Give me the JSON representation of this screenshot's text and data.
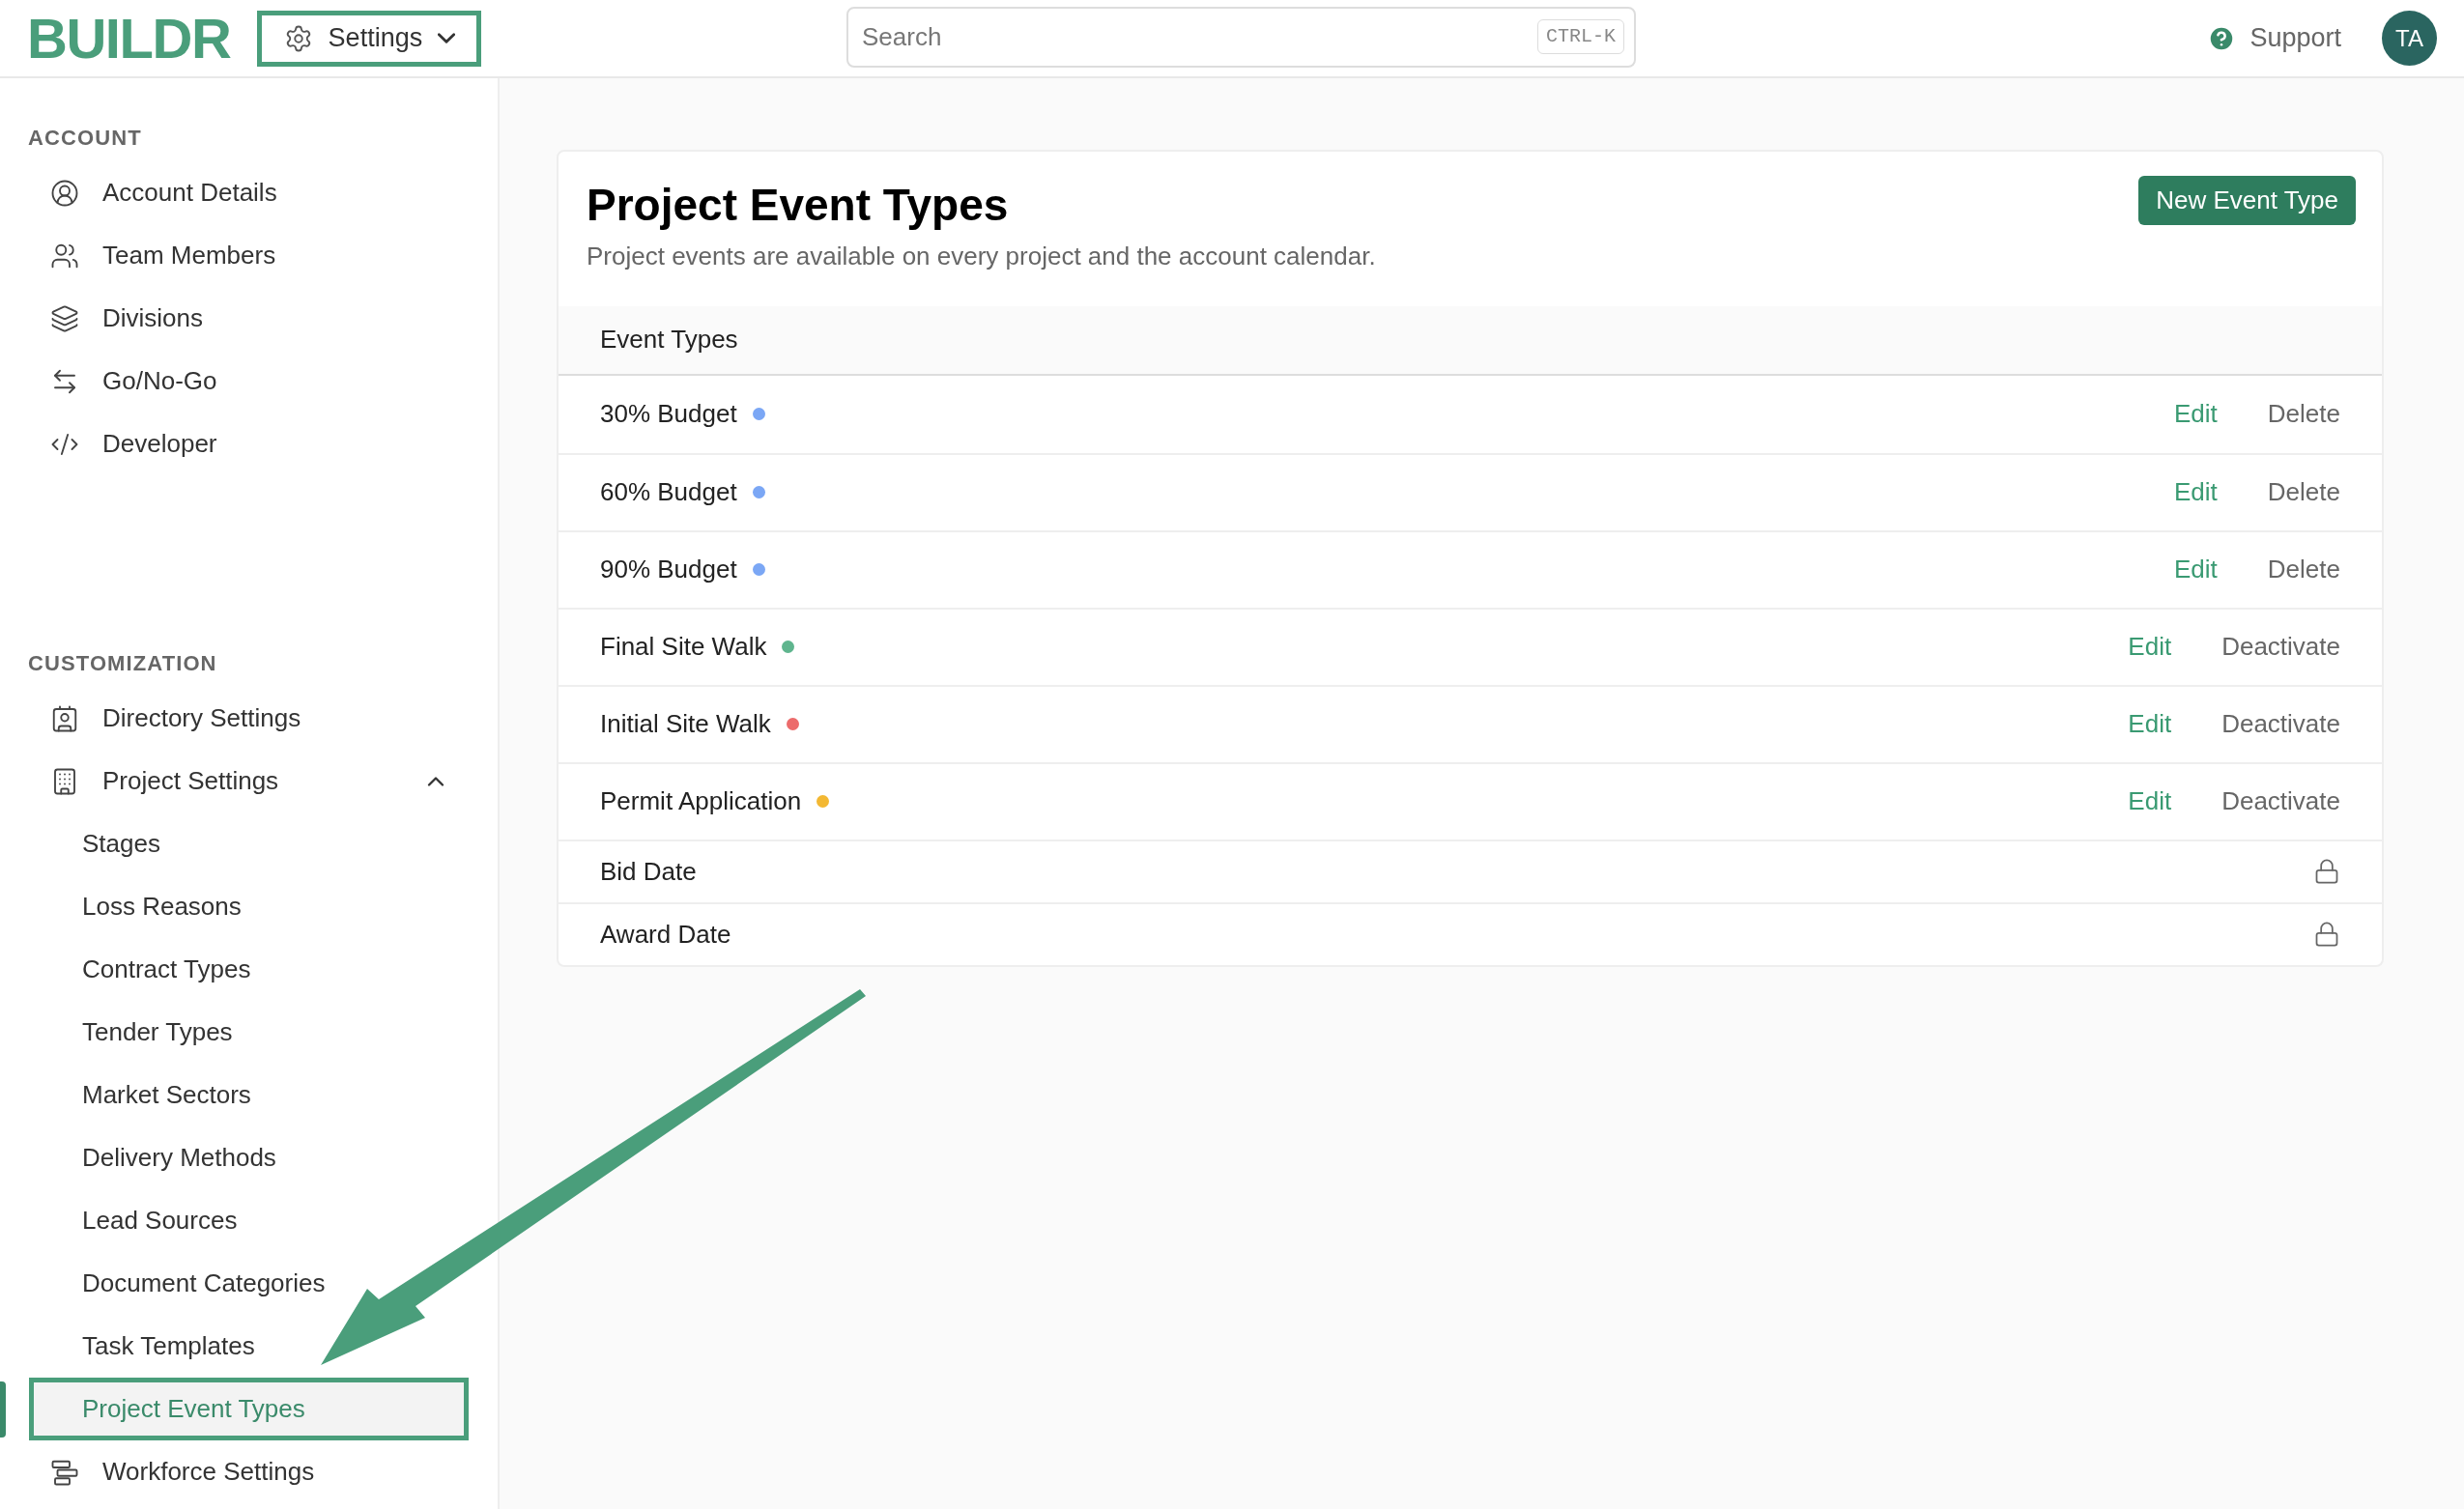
{
  "header": {
    "logo": "BUILDR",
    "menu_button": {
      "label": "Settings"
    },
    "search": {
      "placeholder": "Search",
      "shortcut": "CTRL-K"
    },
    "support": "Support",
    "avatar": "TA"
  },
  "sidebar": {
    "sections": [
      {
        "title": "ACCOUNT",
        "items": [
          {
            "label": "Account Details",
            "selected": false
          },
          {
            "label": "Team Members",
            "selected": false
          },
          {
            "label": "Divisions",
            "selected": false
          },
          {
            "label": "Go/No-Go",
            "selected": false
          },
          {
            "label": "Developer",
            "selected": false
          }
        ]
      },
      {
        "title": "CUSTOMIZATION",
        "items": [
          {
            "label": "Directory Settings",
            "selected": false
          },
          {
            "label": "Project Settings",
            "selected": false,
            "expanded": true,
            "children": [
              {
                "label": "Stages",
                "selected": false
              },
              {
                "label": "Loss Reasons",
                "selected": false
              },
              {
                "label": "Contract Types",
                "selected": false
              },
              {
                "label": "Tender Types",
                "selected": false
              },
              {
                "label": "Market Sectors",
                "selected": false
              },
              {
                "label": "Delivery Methods",
                "selected": false
              },
              {
                "label": "Lead Sources",
                "selected": false
              },
              {
                "label": "Document Categories",
                "selected": false
              },
              {
                "label": "Task Templates",
                "selected": false
              },
              {
                "label": "Project Event Types",
                "selected": true
              }
            ]
          },
          {
            "label": "Workforce Settings",
            "selected": false
          }
        ]
      }
    ]
  },
  "page": {
    "title": "Project Event Types",
    "subtitle": "Project events are available on every project and the account calendar.",
    "new_button": "New Event Type",
    "table": {
      "column": "Event Types",
      "rows": [
        {
          "name": "30% Budget",
          "color": "#7ba7f5",
          "kind": "actions",
          "actions": [
            "Edit",
            "Delete"
          ]
        },
        {
          "name": "60% Budget",
          "color": "#7ba7f5",
          "kind": "actions",
          "actions": [
            "Edit",
            "Delete"
          ]
        },
        {
          "name": "90% Budget",
          "color": "#7ba7f5",
          "kind": "actions",
          "actions": [
            "Edit",
            "Delete"
          ]
        },
        {
          "name": "Final Site Walk",
          "color": "#5fb58e",
          "kind": "actions",
          "actions": [
            "Edit",
            "Deactivate"
          ]
        },
        {
          "name": "Initial Site Walk",
          "color": "#ec6b6b",
          "kind": "actions",
          "actions": [
            "Edit",
            "Deactivate"
          ]
        },
        {
          "name": "Permit Application",
          "color": "#f3b833",
          "kind": "actions",
          "actions": [
            "Edit",
            "Deactivate"
          ]
        },
        {
          "name": "Bid Date",
          "kind": "locked"
        },
        {
          "name": "Award Date",
          "kind": "locked"
        }
      ]
    }
  }
}
